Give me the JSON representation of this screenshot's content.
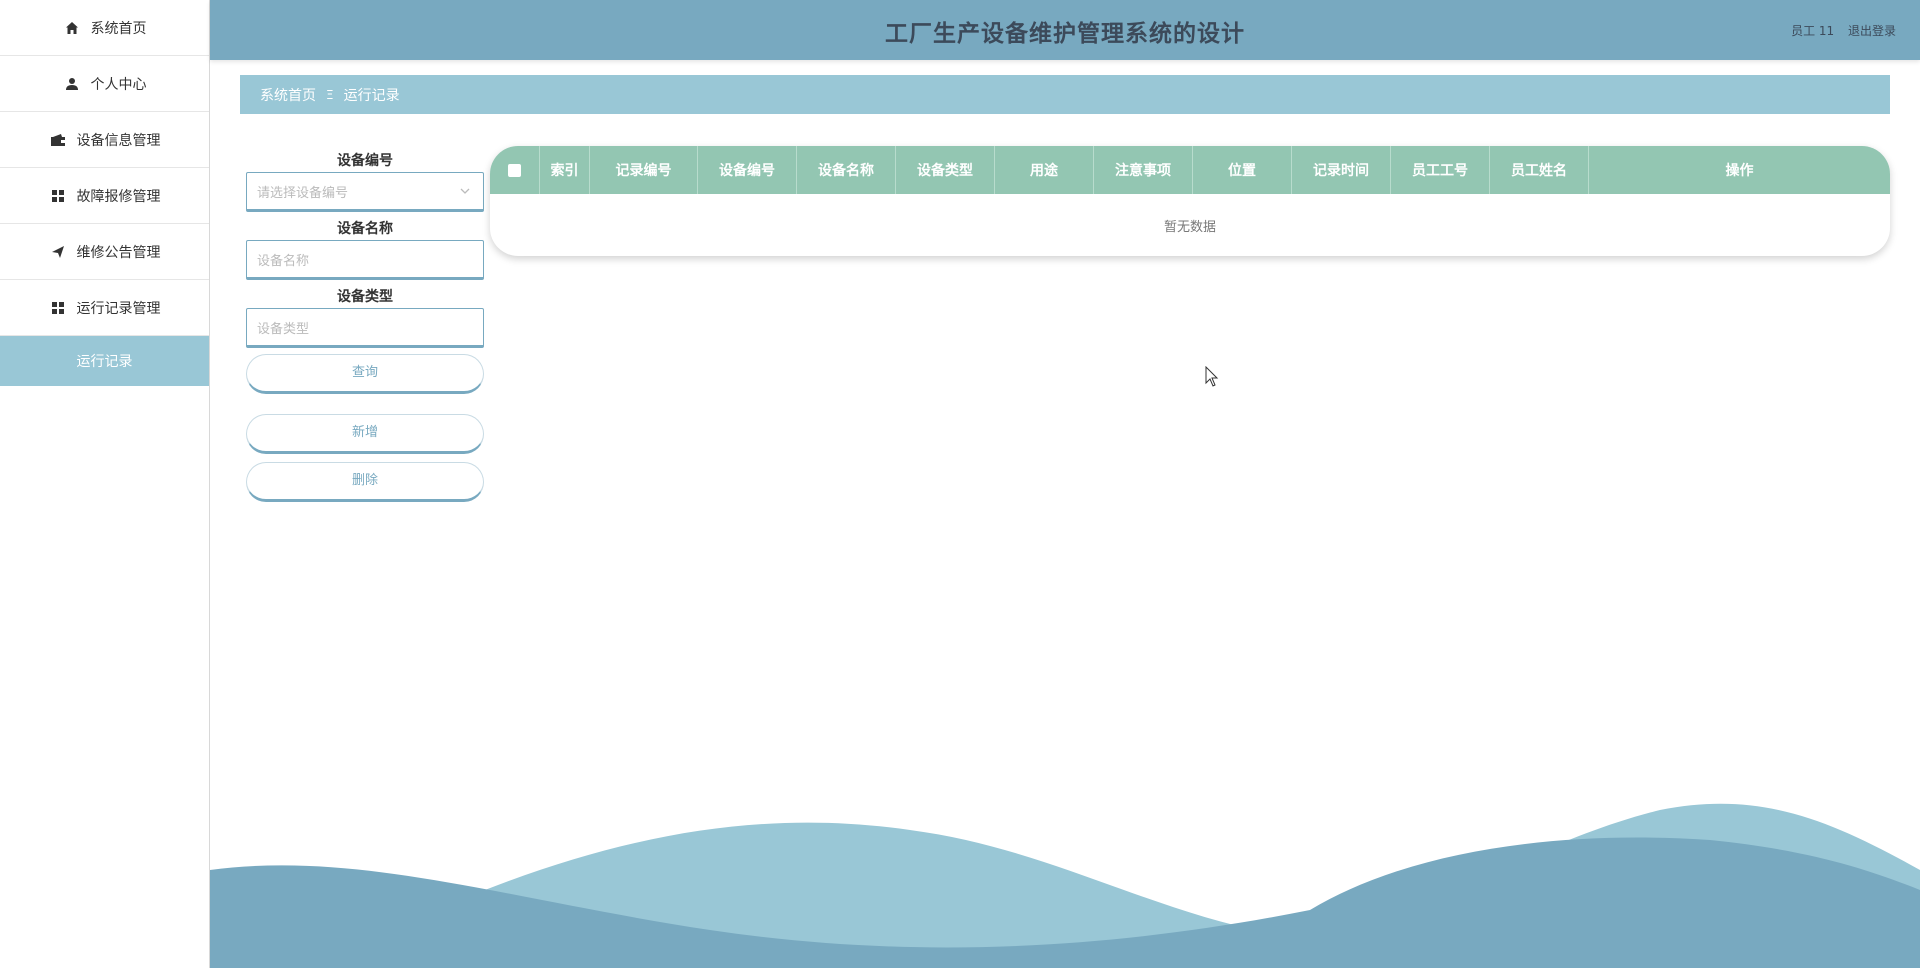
{
  "app": {
    "title": "工厂生产设备维护管理系统的设计"
  },
  "header": {
    "user": "员工 11",
    "logout": "退出登录"
  },
  "sidebar": {
    "items": [
      {
        "label": "系统首页",
        "icon": "home-icon"
      },
      {
        "label": "个人中心",
        "icon": "user-icon"
      },
      {
        "label": "设备信息管理",
        "icon": "wallet-icon"
      },
      {
        "label": "故障报修管理",
        "icon": "grid-icon"
      },
      {
        "label": "维修公告管理",
        "icon": "send-icon"
      },
      {
        "label": "运行记录管理",
        "icon": "grid-icon"
      },
      {
        "label": "运行记录",
        "active": true
      }
    ]
  },
  "breadcrumb": {
    "home": "系统首页",
    "separator": "Ξ",
    "current": "运行记录"
  },
  "search": {
    "device_no_label": "设备编号",
    "device_no_placeholder": "请选择设备编号",
    "device_name_label": "设备名称",
    "device_name_placeholder": "设备名称",
    "device_type_label": "设备类型",
    "device_type_placeholder": "设备类型",
    "query_button": "查询",
    "add_button": "新增",
    "delete_button": "删除"
  },
  "table": {
    "columns": [
      "索引",
      "记录编号",
      "设备编号",
      "设备名称",
      "设备类型",
      "用途",
      "注意事项",
      "位置",
      "记录时间",
      "员工工号",
      "员工姓名",
      "操作"
    ],
    "empty_text": "暂无数据"
  },
  "colors": {
    "header": "#78a9c0",
    "accent": "#99c7d6",
    "table_header": "#93c6b2"
  }
}
